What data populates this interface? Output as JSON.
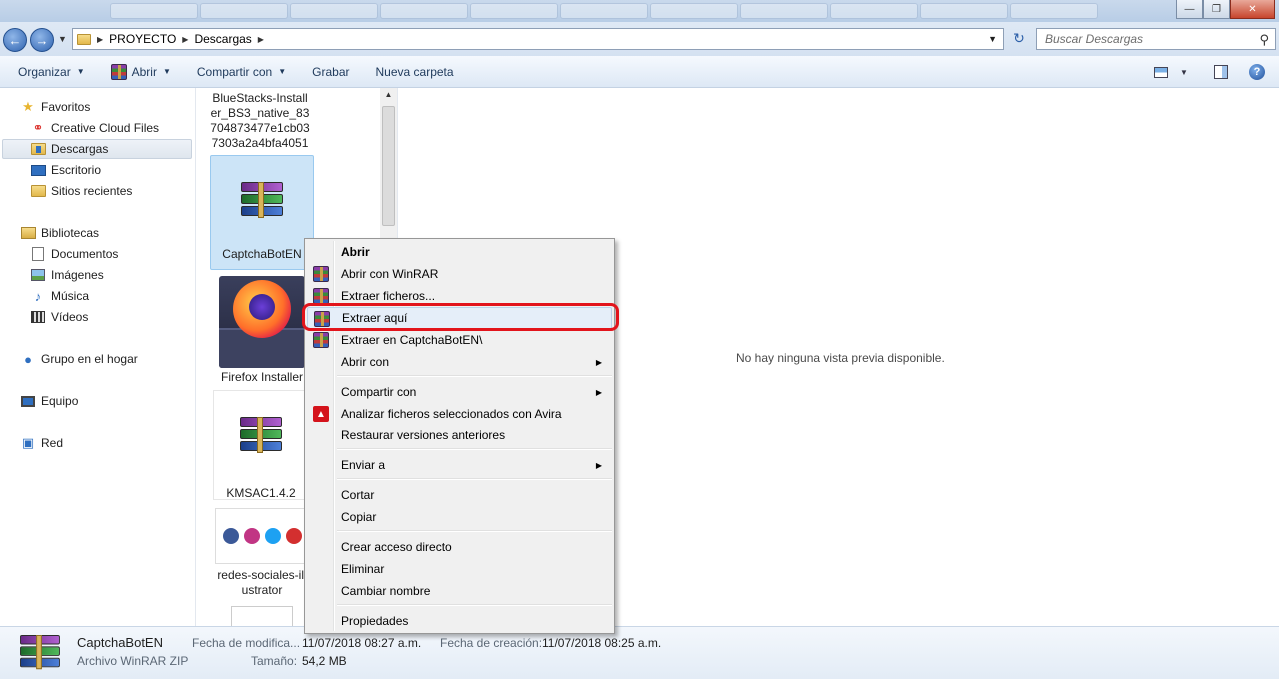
{
  "address": {
    "crumbs": [
      "PROYECTO",
      "Descargas"
    ],
    "search_placeholder": "Buscar Descargas"
  },
  "toolbar": {
    "organize": "Organizar",
    "open": "Abrir",
    "share": "Compartir con",
    "burn": "Grabar",
    "new_folder": "Nueva carpeta"
  },
  "nav": {
    "favorites": "Favoritos",
    "creative_cloud": "Creative Cloud Files",
    "downloads": "Descargas",
    "desktop": "Escritorio",
    "recent": "Sitios recientes",
    "libraries": "Bibliotecas",
    "documents": "Documentos",
    "images": "Imágenes",
    "music": "Música",
    "videos": "Vídeos",
    "homegroup": "Grupo en el hogar",
    "computer": "Equipo",
    "network": "Red"
  },
  "files": {
    "bluestacks": [
      "BlueStacks-Install",
      "er_BS3_native_83",
      "704873477e1cb03",
      "7303a2a4bfa4051"
    ],
    "captcha": "CaptchaBotEN",
    "firefox": "Firefox Installer",
    "kmsac": "KMSAC1.4.2",
    "social": [
      "redes-sociales-ill",
      "ustrator"
    ]
  },
  "preview": {
    "message": "No hay ninguna vista previa disponible."
  },
  "context_menu": {
    "open": "Abrir",
    "open_winrar": "Abrir con WinRAR",
    "extract_files": "Extraer ficheros...",
    "extract_here": "Extraer aquí",
    "extract_to": "Extraer en CaptchaBotEN\\",
    "open_with": "Abrir con",
    "share_with": "Compartir con",
    "avira_scan": "Analizar ficheros seleccionados con Avira",
    "restore": "Restaurar versiones anteriores",
    "send_to": "Enviar a",
    "cut": "Cortar",
    "copy": "Copiar",
    "shortcut": "Crear acceso directo",
    "delete": "Eliminar",
    "rename": "Cambiar nombre",
    "properties": "Propiedades"
  },
  "details": {
    "name": "CaptchaBotEN",
    "type": "Archivo WinRAR ZIP",
    "modified_label": "Fecha de modifica...",
    "modified_value": "11/07/2018 08:27 a.m.",
    "created_label": "Fecha de creación:",
    "created_value": "11/07/2018 08:25 a.m.",
    "size_label": "Tamaño:",
    "size_value": "54,2 MB"
  },
  "colors": {
    "highlight_ring": "#e2141c",
    "selection": "#cce4f7"
  }
}
